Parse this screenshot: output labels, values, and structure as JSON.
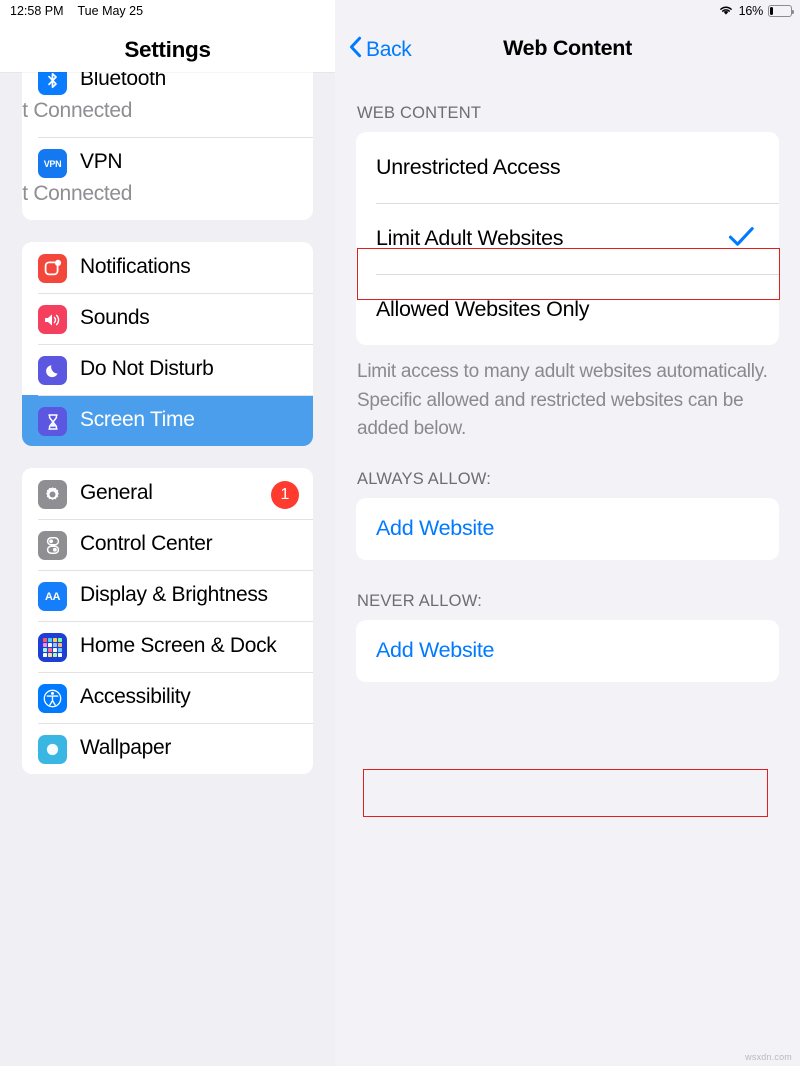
{
  "status_bar": {
    "time": "12:58 PM",
    "date": "Tue May 25",
    "wifi_icon": "wifi-icon",
    "battery_percent": "16%",
    "battery_level": 16
  },
  "sidebar": {
    "title": "Settings",
    "groups": [
      {
        "items": [
          {
            "label": "Bluetooth",
            "subtitle": "Not Connected",
            "icon": "bluetooth-icon",
            "partially_visible": true
          },
          {
            "label": "VPN",
            "subtitle": "Not Connected",
            "icon": "vpn-icon"
          }
        ]
      },
      {
        "items": [
          {
            "label": "Notifications",
            "icon": "notifications-icon"
          },
          {
            "label": "Sounds",
            "icon": "sounds-icon"
          },
          {
            "label": "Do Not Disturb",
            "icon": "moon-icon"
          },
          {
            "label": "Screen Time",
            "icon": "hourglass-icon",
            "selected": true
          }
        ]
      },
      {
        "items": [
          {
            "label": "General",
            "icon": "gear-icon",
            "badge": "1"
          },
          {
            "label": "Control Center",
            "icon": "control-center-icon"
          },
          {
            "label": "Display & Brightness",
            "icon": "display-brightness-icon"
          },
          {
            "label": "Home Screen & Dock",
            "icon": "home-screen-icon"
          },
          {
            "label": "Accessibility",
            "icon": "accessibility-icon"
          },
          {
            "label": "Wallpaper",
            "icon": "wallpaper-icon",
            "partially_visible": true
          }
        ]
      }
    ]
  },
  "detail": {
    "back_label": "Back",
    "back_icon": "chevron-left-icon",
    "title": "Web Content",
    "web_content": {
      "section_header": "WEB CONTENT",
      "options": [
        {
          "label": "Unrestricted Access",
          "selected": false
        },
        {
          "label": "Limit Adult Websites",
          "selected": true,
          "annotated": true
        },
        {
          "label": "Allowed Websites Only",
          "selected": false
        }
      ],
      "checkmark_icon": "checkmark-icon",
      "footnote": "Limit access to many adult websites automatically. Specific allowed and restricted websites can be added below."
    },
    "always_allow": {
      "section_header": "ALWAYS ALLOW:",
      "add_label": "Add Website",
      "annotated": false
    },
    "never_allow": {
      "section_header": "NEVER ALLOW:",
      "add_label": "Add Website",
      "annotated": true
    }
  },
  "watermark": "wsxdn.com",
  "colors": {
    "accent_blue": "#007aff",
    "selection_blue": "#4a9eec",
    "badge_red": "#ff3b30",
    "annotation_red": "#e02020",
    "panel_bg": "#f2f2f7",
    "sidebar_bg": "#efeff4"
  }
}
